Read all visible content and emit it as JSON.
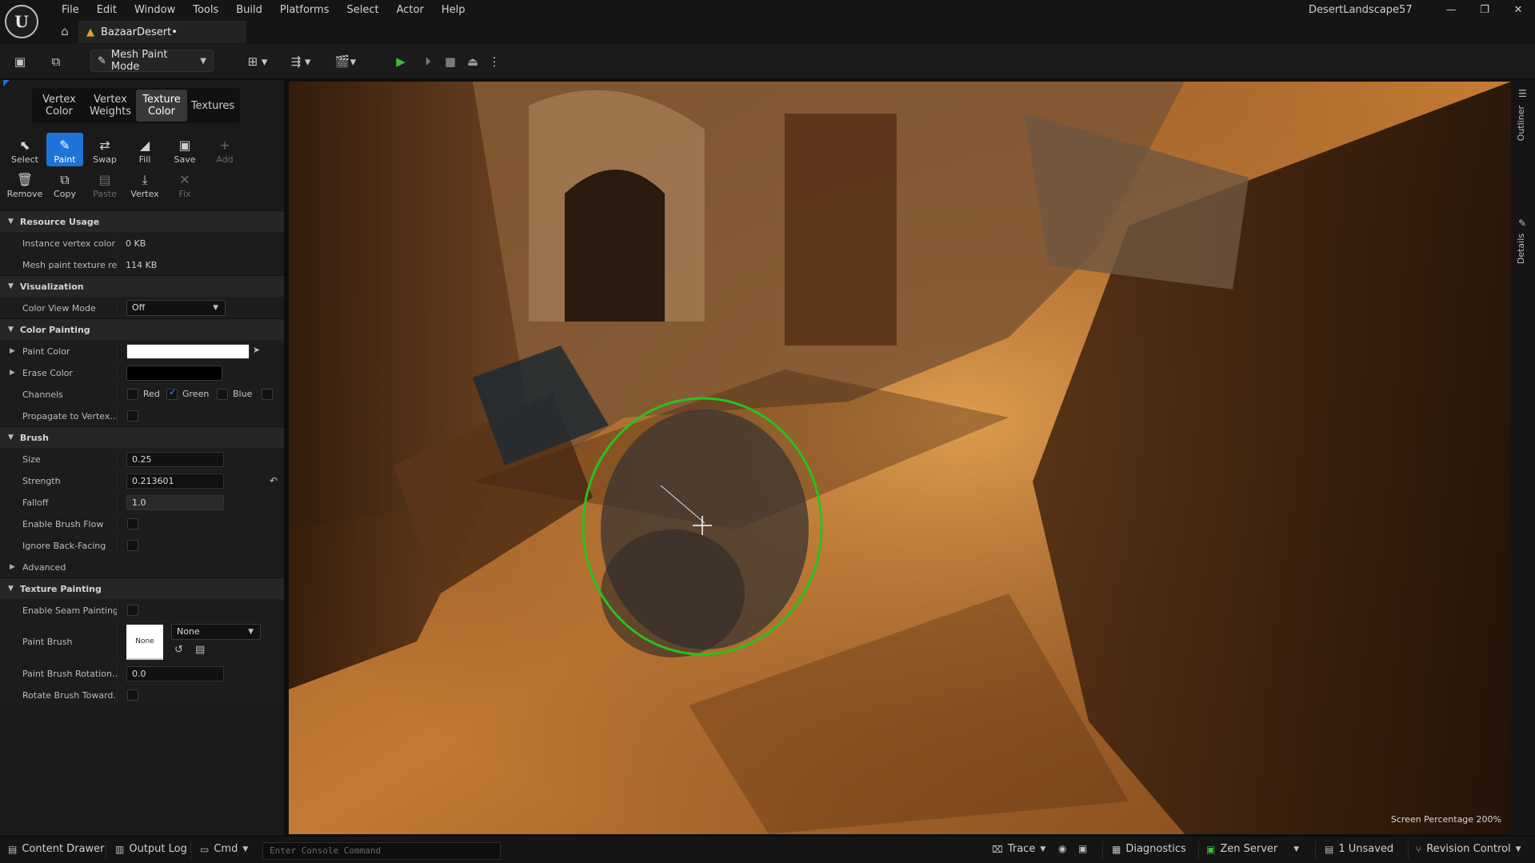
{
  "window": {
    "project_name": "DesertLandscape57",
    "level_tab": "BazaarDesert•",
    "menu": [
      "File",
      "Edit",
      "Window",
      "Tools",
      "Build",
      "Platforms",
      "Select",
      "Actor",
      "Help"
    ],
    "controls": {
      "minimize": "—",
      "restore": "❐",
      "close": "✕"
    }
  },
  "toolbar": {
    "mode": "Mesh Paint Mode"
  },
  "mesh_paint": {
    "tabs": [
      {
        "label": "Vertex\nColor",
        "active": false
      },
      {
        "label": "Vertex\nWeights",
        "active": false
      },
      {
        "label": "Texture\nColor",
        "active": true
      },
      {
        "label": "Textures",
        "active": false
      }
    ],
    "tools": [
      {
        "label": "Select",
        "icon": "cursor-icon",
        "glyph": "⬉",
        "state": "normal"
      },
      {
        "label": "Paint",
        "icon": "brush-icon",
        "glyph": "✎",
        "state": "active"
      },
      {
        "label": "Swap",
        "icon": "swap-icon",
        "glyph": "⇄",
        "state": "normal"
      },
      {
        "label": "Fill",
        "icon": "fill-bucket-icon",
        "glyph": "◢",
        "state": "normal"
      },
      {
        "label": "Save",
        "icon": "save-icon",
        "glyph": "▣",
        "state": "normal"
      },
      {
        "label": "Add",
        "icon": "plus-icon",
        "glyph": "+",
        "state": "disabled"
      },
      {
        "label": "Remove",
        "icon": "trash-icon",
        "glyph": "🗑",
        "state": "normal"
      },
      {
        "label": "Copy",
        "icon": "copy-icon",
        "glyph": "⧉",
        "state": "normal"
      },
      {
        "label": "Paste",
        "icon": "paste-icon",
        "glyph": "▤",
        "state": "disabled"
      },
      {
        "label": "Vertex",
        "icon": "vertex-icon",
        "glyph": "⤓",
        "state": "normal"
      },
      {
        "label": "Fix",
        "icon": "wrench-icon",
        "glyph": "✕",
        "state": "disabled"
      }
    ]
  },
  "details": {
    "resource_usage": {
      "title": "Resource Usage",
      "instance_label": "Instance vertex color s",
      "instance_value": "0 KB",
      "texture_label": "Mesh paint texture res",
      "texture_value": "114 KB"
    },
    "visualization": {
      "title": "Visualization",
      "color_view_label": "Color View Mode",
      "color_view_value": "Off"
    },
    "color_painting": {
      "title": "Color Painting",
      "paint_color_label": "Paint Color",
      "paint_color": "#ffffff",
      "erase_color_label": "Erase Color",
      "erase_color": "#000000",
      "channels_label": "Channels",
      "channels": [
        {
          "name": "Red",
          "checked": false
        },
        {
          "name": "Green",
          "checked": true
        },
        {
          "name": "Blue",
          "checked": false
        }
      ],
      "propagate_label": "Propagate to Vertex..."
    },
    "brush": {
      "title": "Brush",
      "size_label": "Size",
      "size": "0.25",
      "strength_label": "Strength",
      "strength": "0.213601",
      "falloff_label": "Falloff",
      "falloff": "1.0",
      "flow_label": "Enable Brush Flow",
      "backfacing_label": "Ignore Back-Facing",
      "advanced_label": "Advanced"
    },
    "texture_painting": {
      "title": "Texture Painting",
      "seam_label": "Enable Seam Painting",
      "paint_brush_label": "Paint Brush",
      "paint_brush_thumb": "None",
      "paint_brush_value": "None",
      "rotation_label": "Paint Brush Rotation...",
      "rotation": "0.0",
      "rotate_toward_label": "Rotate Brush Toward..."
    }
  },
  "viewport": {
    "screen_percentage": "Screen Percentage  200%",
    "brush_ring_color": "#27c21f"
  },
  "side_tabs": {
    "outliner": "Outliner",
    "details": "Details"
  },
  "statusbar": {
    "content_drawer": "Content Drawer",
    "output_log": "Output Log",
    "cmd": "Cmd",
    "console_placeholder": "Enter Console Command",
    "trace": "Trace",
    "diagnostics": "Diagnostics",
    "zen_server": "Zen Server",
    "unsaved": "1 Unsaved",
    "revision_control": "Revision Control"
  }
}
